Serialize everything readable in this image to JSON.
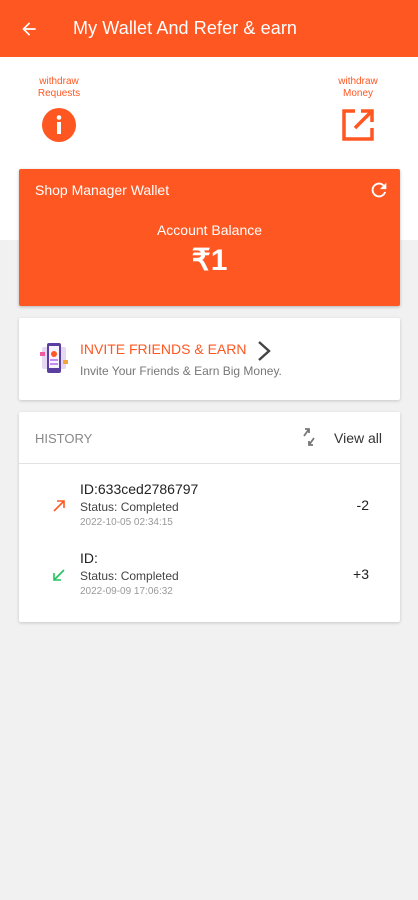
{
  "appbar": {
    "title": "My Wallet And Refer & earn"
  },
  "actions": {
    "withdraw_requests": "withdraw\nRequests",
    "withdraw_money": "withdraw\nMoney"
  },
  "wallet": {
    "title": "Shop Manager Wallet",
    "balance_label": "Account Balance",
    "balance_value": "₹1"
  },
  "invite": {
    "title": "INVITE FRIENDS & EARN",
    "subtitle": "Invite Your Friends & Earn Big Money."
  },
  "history": {
    "title": "HISTORY",
    "view_all": "View all",
    "items": [
      {
        "id": "ID:633ced2786797",
        "status": "Status: Completed",
        "date": "2022-10-05 02:34:15",
        "amount": "-2",
        "direction": "out"
      },
      {
        "id": "ID:",
        "status": "Status: Completed",
        "date": "2022-09-09 17:06:32",
        "amount": "+3",
        "direction": "in"
      }
    ]
  },
  "colors": {
    "accent": "#ff5722",
    "credit": "#22c55e",
    "background": "#f1f1f1"
  },
  "icons": {
    "back": "arrow-left-icon",
    "info": "info-icon",
    "open_external": "open-in-new-icon",
    "refresh": "refresh-icon",
    "invite": "invite-illustration",
    "chevron": "chevron-right-icon",
    "sync": "sync-icon",
    "debit": "arrow-up-right-icon",
    "credit": "arrow-down-left-icon"
  }
}
